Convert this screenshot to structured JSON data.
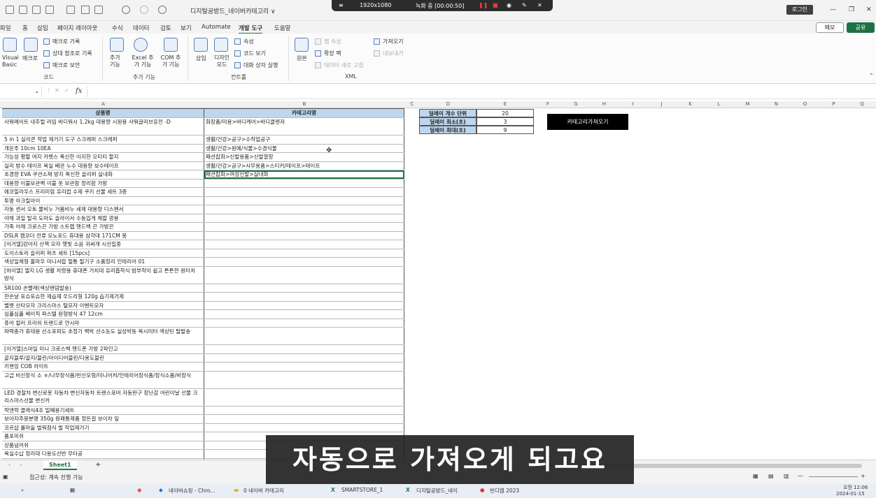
{
  "titlebar": {
    "document_title": "디지털공방드_네이버카테고리 ∨",
    "recorder": {
      "resolution": "1920x1080",
      "status": "녹화 중 [00:00:50]"
    },
    "login_label": "로그인"
  },
  "menubar": {
    "items": [
      "파일",
      "홈",
      "삽입",
      "페이지 레이아웃",
      "수식",
      "데이터",
      "검토",
      "보기",
      "Automate",
      "개발 도구",
      "도움말"
    ],
    "active": "개발 도구",
    "memo_label": "메모",
    "share_label": "공유"
  },
  "ribbon": {
    "code": {
      "vb_label": "Visual Basic",
      "macro_label": "매크로",
      "record_macro": "매크로 기록",
      "relative_ref": "상대 참조로 기록",
      "macro_security": "매크로 보안",
      "group_label": "코드"
    },
    "addins": {
      "addin_label": "추가 기능",
      "excel_addin_label": "Excel 추가 기능",
      "com_addin_label": "COM 추가 기능",
      "group_label": "추가 기능"
    },
    "controls": {
      "insert_label": "삽입",
      "design_mode_label": "디자인 모드",
      "properties": "속성",
      "view_code": "코드 보기",
      "run_dialog": "대화 상자 실행",
      "group_label": "컨트롤"
    },
    "xml": {
      "source_label": "원본",
      "map_properties": "맵 속성",
      "expansion_pack": "확장 팩",
      "refresh_data": "데이터 새로 고침",
      "import": "가져오기",
      "export": "내보내기",
      "group_label": "XML"
    }
  },
  "formula_bar": {
    "fx": "fx"
  },
  "columns": [
    "A",
    "B",
    "C",
    "D",
    "E",
    "F",
    "G",
    "H",
    "I",
    "J",
    "K",
    "L",
    "M",
    "N",
    "O",
    "P",
    "Q"
  ],
  "table": {
    "header_a": "상품명",
    "header_b": "카테고리명",
    "rows": [
      [
        "사워메이트 내추럴 라임 바디워시 1.2kg 대용량 시원용 샤워글리브유전 -D",
        "화장품/미용>바디케어>바디클렌저"
      ],
      [
        "5 in 1 실리콘 작업 제거기 도구 스크래퍼 스크레퍼",
        "생활/건강>공구>수작업공구"
      ],
      [
        "개운주 10cm 10EA",
        "생활/건강>원예/식물>수경식물"
      ],
      [
        "가능성 평할 여지 카펫스 폭신한 이지헌 오티티 팔지",
        "패션잡화>신발용품>신발깔창"
      ],
      [
        "실리 방수 테이프 욕실 배관 누수 대용량 보수테이프",
        "생활/건강>공구>사무용품>스티커/테이프>테이프"
      ],
      [
        "초경량 EVA 쿠션소재 방지 푹신한 슬리퍼 실내화",
        "패션잡화>여성신발>실내화"
      ],
      [
        "대용량 이불보관백 이불 옷 보관함 정리함 가방",
        ""
      ],
      [
        "에코밀라우스 프리미엄 유리컵 수제 쿠키 선물 세트 3종",
        ""
      ],
      [
        "투명 아크릴아이",
        ""
      ],
      [
        "자동 센서 오토 물비누 거품비누 세제 대용량 디스펜서",
        ""
      ],
      [
        "야채 과일 탈곡 도마도 슬라이서 수동입게 채칼 광용",
        ""
      ],
      [
        "가죽 어깨 크로스끈 가방 스트랩 핸드백 끈 가방끈",
        ""
      ],
      [
        "DSLR 캠코더 전류 모노포드 휴대용 삼각대 171CM 봉",
        ""
      ],
      [
        "[이거엘]강아지 산책 모자 햇빛 소음 귀싸개 시선집중",
        ""
      ],
      [
        "도이스토리 슬리퍼 파츠 세트 [15pcs]",
        ""
      ],
      [
        "색상일체형 볼마우 미니서랍 필통 필기구 소품정리 인테리어 01",
        ""
      ],
      [
        "[하이엘] 엘지 LG 생활 차량용 휴대폰 거치대 유리흡착식 밤부착이 쉽고 튼튼한 원터치 방식",
        ""
      ],
      [
        "SR100 손빨래(색상랜덤발송)",
        ""
      ],
      [
        "한손날 포슈포슈한 제습제 우드리형 120g 습기제거제",
        ""
      ],
      [
        "벨벳 산타모자 크리스마스 털모자 이벤트모자",
        ""
      ],
      [
        "심플심플 베이직 파스텔 원형방식 47 12cm",
        ""
      ],
      [
        "퓨어 컬러 프리쉬 트랜드로 얀시마",
        ""
      ],
      [
        "파력충가 휴대용 선소포피도 초정기 백박 선소농도 실성박동 목시미터 색상틴 탈발송",
        ""
      ],
      [
        "[이거엘]스마일 미니 크로스백 핸드폰 가방 2파인고",
        ""
      ],
      [
        "골지블루/골지/블린/아이디어블린/다용도블린",
        ""
      ],
      [
        "키첸잉 COB 라이트",
        ""
      ],
      [
        "고급 비신장식 소 ㅎ/나무장식품/빈신모형/미니어처/인테리어장식품/장식소품/비장식",
        ""
      ],
      [
        "LED 경찰차 변신로봇 자동차 변신자동차 트랜스포머 자동완구 장난감 어린이날 선물 크리스마스선물 변신카",
        ""
      ],
      [
        "락앤락 클래식4조 밀폐용기세트",
        ""
      ],
      [
        "보아자주몽분명 350g 원패통제품 정든걸 보이차 잎",
        ""
      ],
      [
        "코르샵 롤마을 벌워점식 벌 작업제거기",
        ""
      ],
      [
        "품포미쉬",
        ""
      ],
      [
        "상품넘러쉬",
        ""
      ],
      [
        "욕실수납 정리대 다용도선반 무타공",
        ""
      ],
      [
        "아이들나 고충 플러웨이즈 8봉 다다르 1m 자석",
        ""
      ]
    ]
  },
  "settings": {
    "delay_unit_label": "딜레이 개수 단위",
    "delay_unit_value": "20",
    "delay_min_label": "딜레이 최소(초)",
    "delay_min_value": "3",
    "delay_max_label": "딜레이 최대(초)",
    "delay_max_value": "9"
  },
  "fetch_button_label": "카테고리가져오기",
  "sheet": {
    "tab": "Sheet1",
    "add": "+"
  },
  "status": {
    "accessibility": "접근성: 계속 진행 가능"
  },
  "taskbar": {
    "items": [
      "네이버쇼핑 - Chro...",
      "0 네이버 카테고리",
      "SMARTSTORE_1",
      "디지털공방드_네이",
      "빈디엠 2023"
    ],
    "time": "오전 12:06",
    "date": "2024-01-15"
  },
  "subtitle": "자동으로 가져오게 되고요"
}
